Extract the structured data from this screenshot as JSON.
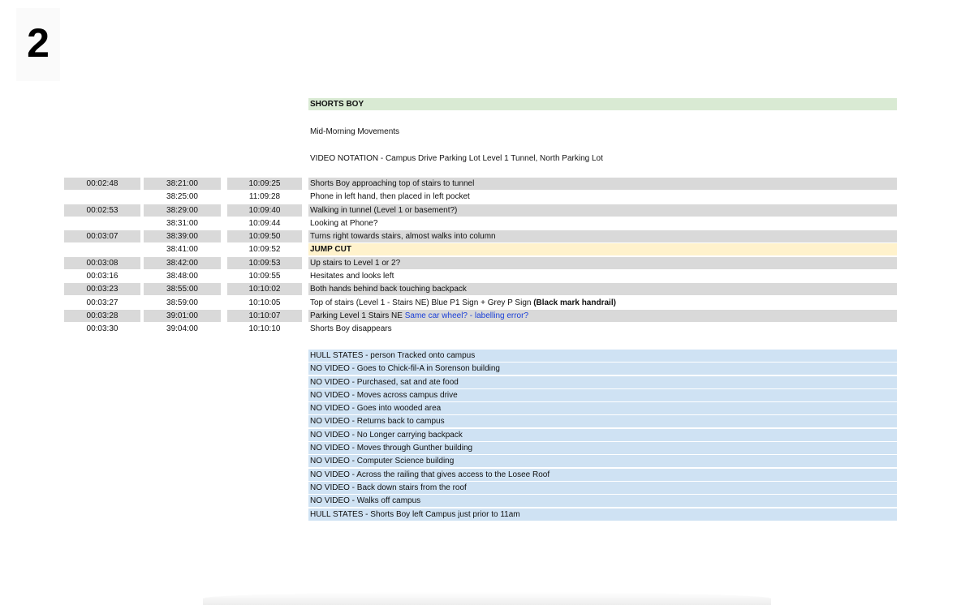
{
  "page_number": "2",
  "header": {
    "title": "SHORTS BOY",
    "subtitle": "Mid-Morning Movements",
    "notation": "VIDEO NOTATION - Campus Drive Parking Lot Level 1 Tunnel, North Parking Lot"
  },
  "rows": [
    {
      "t1": "00:02:48",
      "t2": "38:21:00",
      "t3": "10:09:25",
      "desc": "Shorts Boy approaching top of stairs to tunnel",
      "desc_bold": "",
      "desc_blue": ""
    },
    {
      "t1": "",
      "t2": "38:25:00",
      "t3": "11:09:28",
      "desc": "Phone in left hand, then placed in left pocket",
      "desc_bold": "",
      "desc_blue": ""
    },
    {
      "t1": "00:02:53",
      "t2": "38:29:00",
      "t3": "10:09:40",
      "desc": "Walking in tunnel (Level 1 or basement?)",
      "desc_bold": "",
      "desc_blue": ""
    },
    {
      "t1": "",
      "t2": "38:31:00",
      "t3": "10:09:44",
      "desc": "Looking at Phone?",
      "desc_bold": "",
      "desc_blue": ""
    },
    {
      "t1": "00:03:07",
      "t2": "38:39:00",
      "t3": "10:09:50",
      "desc": "Turns right towards stairs, almost walks into column",
      "desc_bold": "",
      "desc_blue": ""
    },
    {
      "t1": "",
      "t2": "38:41:00",
      "t3": "10:09:52",
      "desc": "JUMP CUT",
      "desc_bold": "",
      "desc_blue": ""
    },
    {
      "t1": "00:03:08",
      "t2": "38:42:00",
      "t3": "10:09:53",
      "desc": "Up stairs to Level 1 or 2?",
      "desc_bold": "",
      "desc_blue": ""
    },
    {
      "t1": "00:03:16",
      "t2": "38:48:00",
      "t3": "10:09:55",
      "desc": "Hesitates and looks left",
      "desc_bold": "",
      "desc_blue": ""
    },
    {
      "t1": "00:03:23",
      "t2": "38:55:00",
      "t3": "10:10:02",
      "desc": "Both hands behind back touching backpack",
      "desc_bold": "",
      "desc_blue": ""
    },
    {
      "t1": "00:03:27",
      "t2": "38:59:00",
      "t3": "10:10:05",
      "desc": "Top of stairs (Level 1 - Stairs NE) Blue P1 Sign + Grey P Sign ",
      "desc_bold": "(Black mark handrail)",
      "desc_blue": ""
    },
    {
      "t1": "00:03:28",
      "t2": "39:01:00",
      "t3": "10:10:07",
      "desc": "Parking Level 1 Stairs NE ",
      "desc_bold": "",
      "desc_blue": "Same car wheel? - labelling error?"
    },
    {
      "t1": "00:03:30",
      "t2": "39:04:00",
      "t3": "10:10:10",
      "desc": "Shorts Boy disappears",
      "desc_bold": "",
      "desc_blue": ""
    }
  ],
  "no_video": [
    "HULL STATES - person Tracked onto campus",
    "NO VIDEO - Goes to Chick-fil-A in Sorenson building",
    "NO VIDEO - Purchased, sat and ate food",
    "NO VIDEO - Moves across campus drive",
    "NO VIDEO - Goes into wooded area",
    "NO VIDEO - Returns back to campus",
    "NO VIDEO - No Longer carrying backpack",
    "NO VIDEO - Moves through Gunther building",
    "NO VIDEO - Computer Science building",
    "NO VIDEO - Across the railing that gives access to the Losee Roof",
    "NO VIDEO - Back down stairs from the roof",
    "NO VIDEO - Walks off campus",
    "HULL STATES - Shorts Boy left Campus just prior to 11am"
  ],
  "colors": {
    "title_bg": "#d9ead3",
    "shaded_row": "#d9d9d9",
    "jump_cut_bg": "#fff2cc",
    "no_video_bg": "#cfe2f3",
    "note_blue": "#1a3fd8"
  }
}
